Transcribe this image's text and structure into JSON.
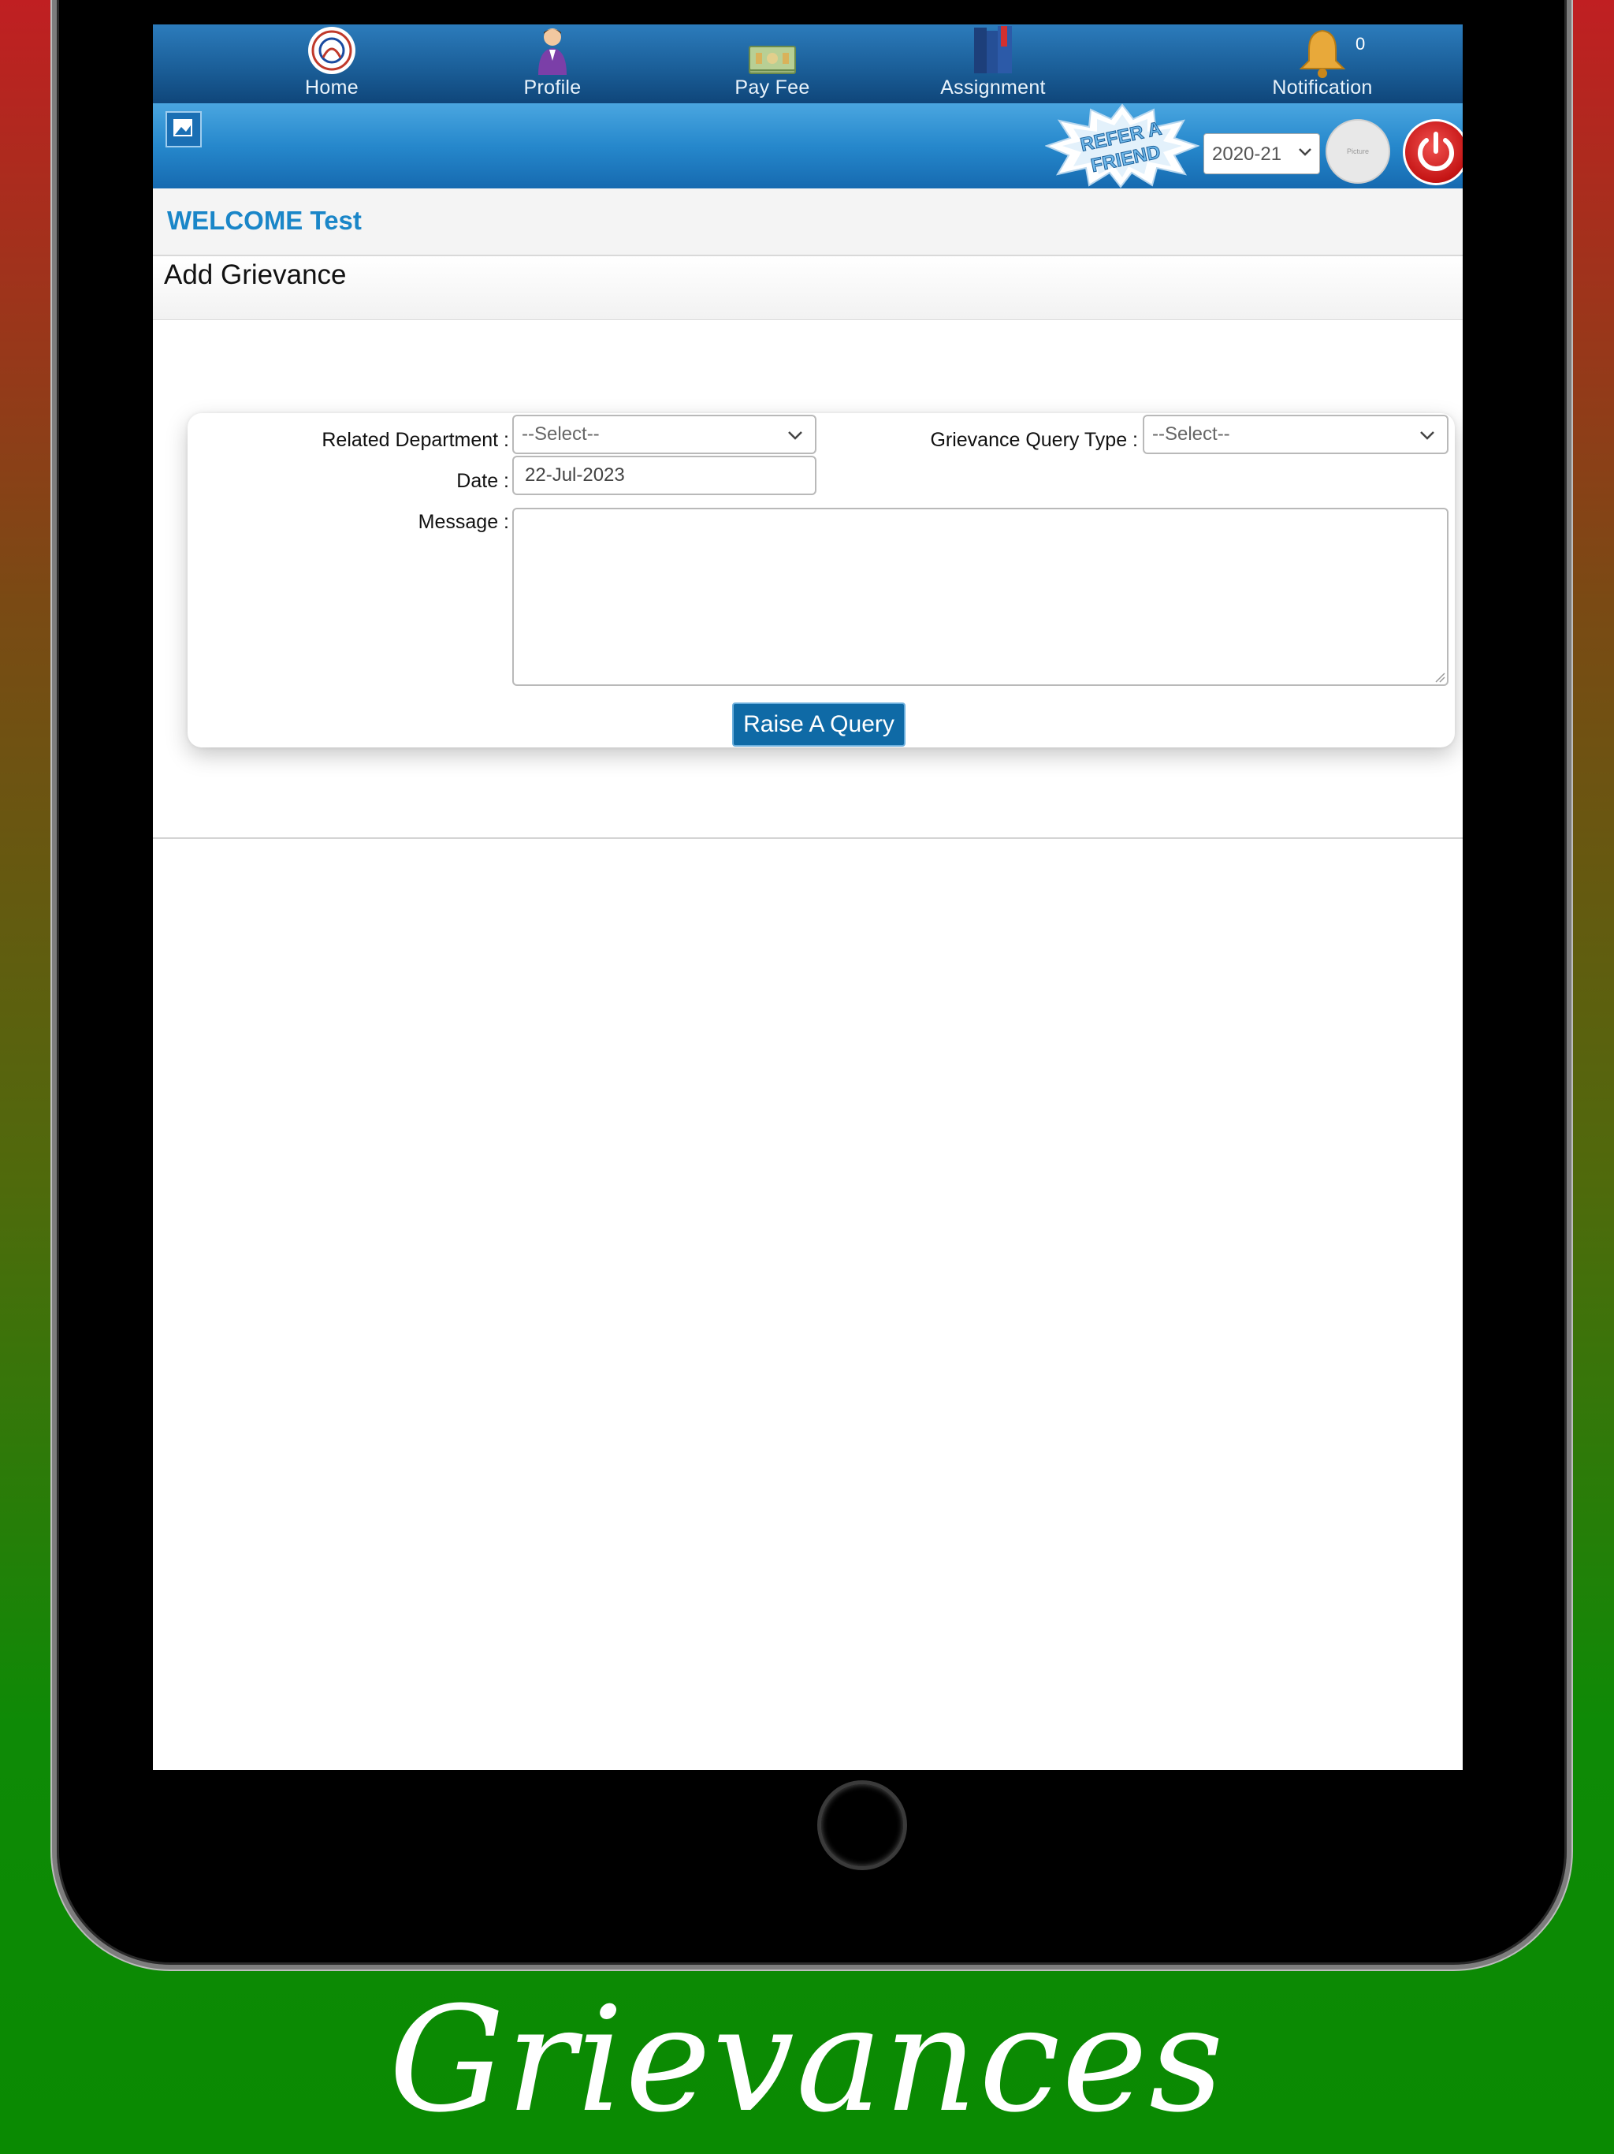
{
  "nav": {
    "items": [
      {
        "label": "Home",
        "icon": "school-logo-icon"
      },
      {
        "label": "Profile",
        "icon": "student-icon"
      },
      {
        "label": "Pay Fee",
        "icon": "money-icon"
      },
      {
        "label": "Assignment",
        "icon": "books-icon"
      },
      {
        "label": "Notification",
        "icon": "bell-icon"
      }
    ],
    "notification_count": "0"
  },
  "header": {
    "refer_line1": "REFER A",
    "refer_line2": "FRIEND",
    "year_value": "2020-21",
    "avatar_text": "Picture"
  },
  "welcome": "WELCOME Test",
  "page_title": "Add Grievance",
  "form": {
    "department_label": "Related Department :",
    "department_value": "--Select--",
    "query_type_label": "Grievance Query Type :",
    "query_type_value": "--Select--",
    "date_label": "Date :",
    "date_value": "22-Jul-2023",
    "message_label": "Message :",
    "message_value": "",
    "submit_label": "Raise A Query"
  },
  "caption": "Grievances",
  "colors": {
    "nav_blue": "#1b5f99",
    "welcome_blue": "#1a86c8",
    "button_blue": "#0f6aa6",
    "logout_red": "#c41414"
  }
}
